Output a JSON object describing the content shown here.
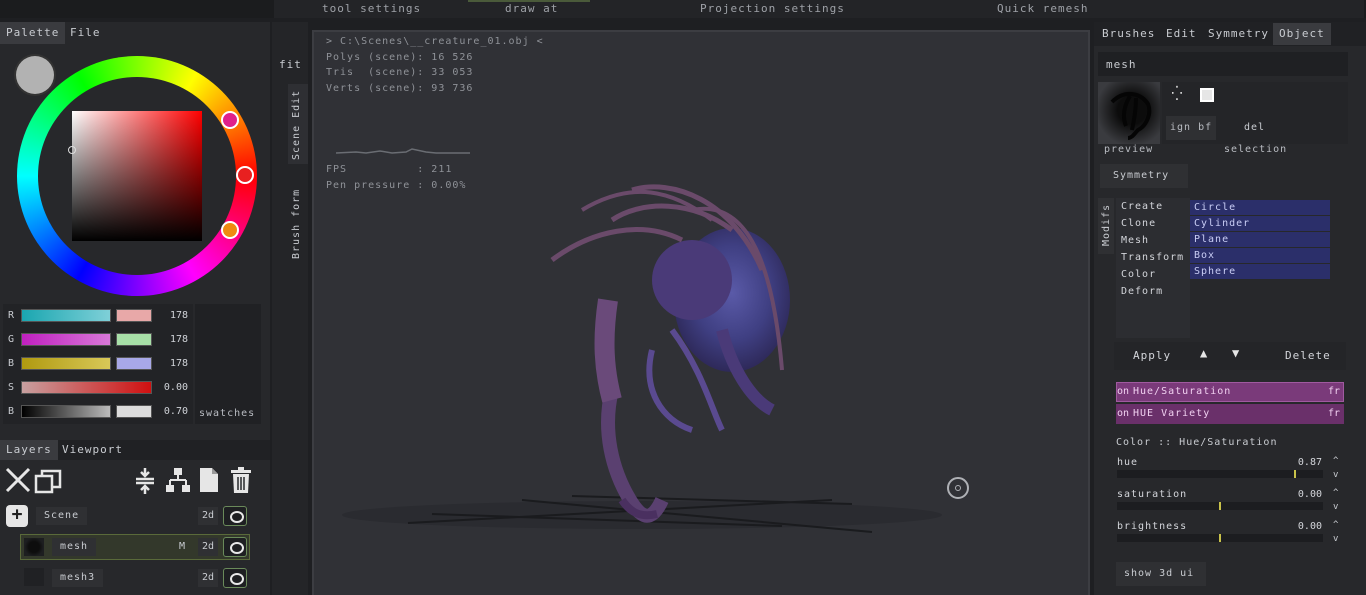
{
  "top_bar": {
    "tool_settings": "tool settings",
    "draw_at": "draw at",
    "projection_settings": "Projection settings",
    "quick_remesh": "Quick remesh"
  },
  "left_panel": {
    "tabs": [
      "Palette",
      "File"
    ],
    "channels": [
      {
        "label": "R",
        "value": "178"
      },
      {
        "label": "G",
        "value": "178"
      },
      {
        "label": "B",
        "value": "178"
      },
      {
        "label": "S",
        "value": "0.00"
      },
      {
        "label": "B",
        "value": "0.70"
      }
    ],
    "swatches_label": "swatches",
    "layers_tabs": [
      "Layers",
      "Viewport"
    ],
    "layers": [
      {
        "name": "Scene",
        "tag": "2d",
        "flag": ""
      },
      {
        "name": "mesh",
        "tag": "2d",
        "flag": "M"
      },
      {
        "name": "mesh3",
        "tag": "2d",
        "flag": ""
      }
    ]
  },
  "side_strip": {
    "fit": "fit",
    "scene_edit": "Scene Edit",
    "brush_form": "Brush form"
  },
  "viewport": {
    "path": "> C:\\Scenes\\__creature_01.obj <",
    "polys": "Polys (scene): 16 526",
    "tris": "Tris  (scene): 33 053",
    "verts": "Verts (scene): 93 736",
    "fps": "FPS          : 211",
    "pen_pressure": "Pen pressure : 0.00%"
  },
  "right_panel": {
    "tabs": [
      "Brushes",
      "Edit",
      "Symmetry",
      "Object"
    ],
    "object_name": "mesh",
    "preview_label": "preview",
    "selection_label": "selection",
    "ign_bf": "ign bf",
    "del": "del",
    "symmetry_button": "Symmetry",
    "modifs_label": "Modifs",
    "modifiers": [
      "Create",
      "Clone",
      "Mesh",
      "Transform",
      "Color",
      "Deform"
    ],
    "primitives": [
      "Circle",
      "Cylinder",
      "Plane",
      "Box",
      "Sphere"
    ],
    "apply": "Apply",
    "delete": "Delete",
    "stack": [
      {
        "on": "on",
        "name": "Hue/Saturation",
        "fr": "fr"
      },
      {
        "on": "on",
        "name": "HUE Variety",
        "fr": "fr"
      }
    ],
    "section_title": "Color :: Hue/Saturation",
    "sliders": [
      {
        "label": "hue",
        "value": "0.87",
        "fraction": 0.87
      },
      {
        "label": "saturation",
        "value": "0.00",
        "fraction": 0.5
      },
      {
        "label": "brightness",
        "value": "0.00",
        "fraction": 0.5
      }
    ],
    "show_3d_ui": "show 3d ui"
  }
}
